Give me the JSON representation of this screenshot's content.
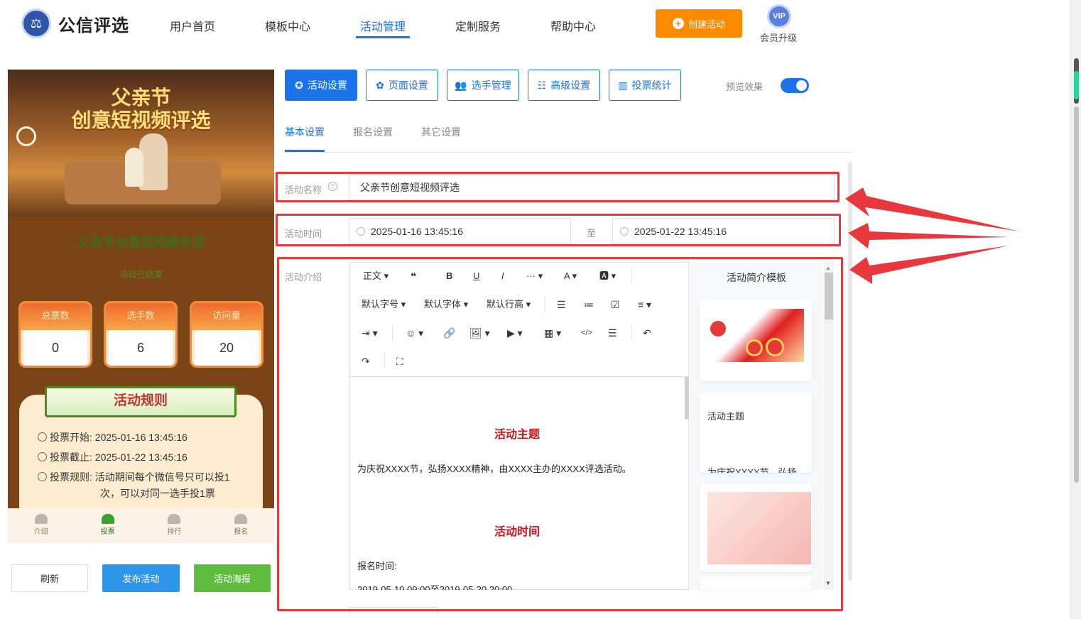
{
  "header": {
    "logo_icon": "scales-icon",
    "brand": "公信评选",
    "nav": [
      {
        "label": "用户首页"
      },
      {
        "label": "模板中心"
      },
      {
        "label": "活动管理"
      },
      {
        "label": "定制服务"
      },
      {
        "label": "帮助中心"
      }
    ],
    "active_nav": "活动管理",
    "create_label": "创建活动",
    "vip_badge": "VIP",
    "vip_label": "会员升级",
    "accent_color": "#1a73e8",
    "create_color": "#ff8a00"
  },
  "preview": {
    "banner_line1": "父亲节",
    "banner_line2": "创意短视频评选",
    "title": "父亲节创意短视频评选",
    "status": "活动已结束",
    "stats": [
      {
        "label": "总票数",
        "value": "0"
      },
      {
        "label": "选手数",
        "value": "6"
      },
      {
        "label": "访问量",
        "value": "20"
      }
    ],
    "rules_title": "活动规则",
    "rules": [
      {
        "label": "投票开始:",
        "value": "2025-01-16 13:45:16"
      },
      {
        "label": "投票截止:",
        "value": "2025-01-22 13:45:16"
      },
      {
        "label": "投票规则:",
        "value": "活动期间每个微信号只可以投1",
        "value2": "次，可以对同一选手投1票"
      }
    ],
    "tabbar": [
      {
        "label": "介绍"
      },
      {
        "label": "投票"
      },
      {
        "label": "排行"
      },
      {
        "label": "报名"
      }
    ],
    "active_tab": "投票"
  },
  "actions": {
    "refresh": "刷新",
    "publish": "发布活动",
    "poster": "活动海报"
  },
  "settings_tabs": [
    {
      "label": "活动设置",
      "icon": "star-icon"
    },
    {
      "label": "页面设置",
      "icon": "gear-icon"
    },
    {
      "label": "选手管理",
      "icon": "users-icon"
    },
    {
      "label": "高级设置",
      "icon": "sliders-icon"
    },
    {
      "label": "投票统计",
      "icon": "bar-chart-icon"
    }
  ],
  "preview_toggle": {
    "label": "预览效果",
    "on": true
  },
  "sub_tabs": [
    {
      "label": "基本设置"
    },
    {
      "label": "报名设置"
    },
    {
      "label": "其它设置"
    }
  ],
  "form": {
    "name_label": "活动名称",
    "name_value": "父亲节创意短视频评选",
    "time_label": "活动时间",
    "start_time": "2025-01-16 13:45:16",
    "to_label": "至",
    "end_time": "2025-01-22 13:45:16",
    "intro_label": "活动介绍"
  },
  "editor": {
    "toolbar_row1": [
      "正文 ▾",
      "❝",
      "B",
      "U",
      "I",
      "··· ▾",
      "A ▾",
      "🅰 ▾"
    ],
    "toolbar_row2": [
      "默认字号 ▾",
      "默认字体 ▾",
      "默认行高 ▾",
      "☰",
      "≔",
      "☑",
      "≡ ▾"
    ],
    "toolbar_row3": [
      "⇥ ▾",
      "☺ ▾",
      "🔗",
      "🖼 ▾",
      "▶ ▾",
      "▦ ▾",
      "</>",
      "☰",
      "↶"
    ],
    "toolbar_row4": [
      "↷",
      "⛶"
    ],
    "heading1": "活动主题",
    "para1": "为庆祝XXXX节，弘扬XXXX精神，由XXXX主办的XXXX评选活动。",
    "heading2": "活动时间",
    "para2": "报名时间:",
    "para3": "2019-05-10 09:00至2019-05-20 20:00"
  },
  "templates": {
    "title": "活动简介模板",
    "card2_title": "活动主题",
    "card2_text": "为庆祝XXXX节，弘扬"
  },
  "annotation_color": "#e8383d"
}
